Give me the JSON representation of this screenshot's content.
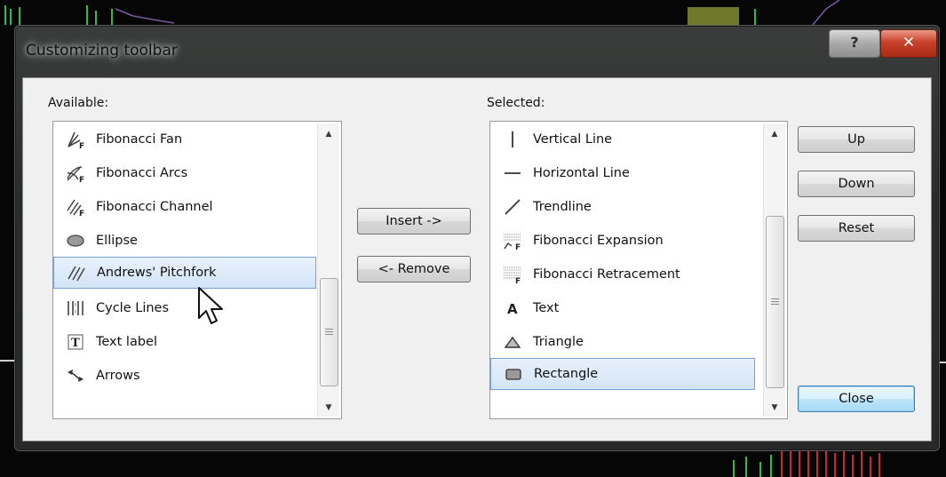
{
  "dialog": {
    "title": "Customizing toolbar",
    "help_label": "?",
    "close_label": "✕"
  },
  "available": {
    "label": "Available:",
    "items": [
      {
        "label": "Fibonacci Fan",
        "icon": "fibonacci-fan-icon"
      },
      {
        "label": "Fibonacci Arcs",
        "icon": "fibonacci-arcs-icon"
      },
      {
        "label": "Fibonacci Channel",
        "icon": "fibonacci-channel-icon"
      },
      {
        "label": "Ellipse",
        "icon": "ellipse-icon"
      },
      {
        "label": "Andrews' Pitchfork",
        "icon": "pitchfork-icon",
        "selected": true
      },
      {
        "label": "Cycle Lines",
        "icon": "cycle-lines-icon"
      },
      {
        "label": "Text label",
        "icon": "text-label-icon"
      },
      {
        "label": "Arrows",
        "icon": "arrows-icon"
      }
    ]
  },
  "selected": {
    "label": "Selected:",
    "items": [
      {
        "label": "Vertical Line",
        "icon": "vertical-line-icon"
      },
      {
        "label": "Horizontal Line",
        "icon": "horizontal-line-icon"
      },
      {
        "label": "Trendline",
        "icon": "trendline-icon"
      },
      {
        "label": "Fibonacci Expansion",
        "icon": "fibonacci-expansion-icon"
      },
      {
        "label": "Fibonacci Retracement",
        "icon": "fibonacci-retracement-icon"
      },
      {
        "label": "Text",
        "icon": "text-icon"
      },
      {
        "label": "Triangle",
        "icon": "triangle-icon"
      },
      {
        "label": "Rectangle",
        "icon": "rectangle-icon",
        "selected": true
      }
    ]
  },
  "buttons": {
    "insert": "Insert ->",
    "remove": "<- Remove",
    "up": "Up",
    "down": "Down",
    "reset": "Reset",
    "close": "Close"
  },
  "colors": {
    "selection_fill": "#d3e4f7",
    "selection_border": "#7ba2cf",
    "close_button": "#c8412a"
  }
}
